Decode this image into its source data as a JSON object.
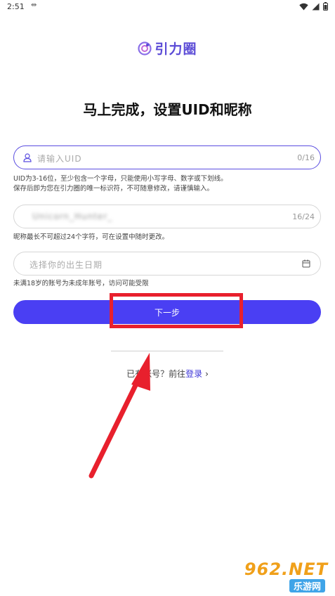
{
  "status_bar": {
    "time": "2:51",
    "extra": "⇹"
  },
  "logo": {
    "text": "引力圈"
  },
  "title": "马上完成，设置UID和昵称",
  "uid_field": {
    "placeholder": "请输入UID",
    "counter": "0/16"
  },
  "uid_hint": {
    "line1": "UID为3-16位，至少包含一个字母，只能使用小写字母、数字或下划线。",
    "line2": "保存后即为您在引力圈的唯一标识符，不可随意修改，请谨慎输入。"
  },
  "nickname_field": {
    "value": "Unicorn_Hunter_",
    "counter": "16/24"
  },
  "nickname_hint": "昵称最长不可超过24个字符，可在设置中随时更改。",
  "birthday_field": {
    "placeholder": "选择你的出生日期"
  },
  "birthday_hint": "未满18岁的账号为未成年账号，访问可能受限",
  "next_button": "下一步",
  "login_row": {
    "prefix": "已有账号？前往",
    "link": "登录",
    "chevron": "›"
  },
  "watermark": {
    "main": "962.NET",
    "sub": "乐游网"
  },
  "colors": {
    "accent": "#4a3ff3",
    "brand": "#5b4bd6",
    "annotation": "#e8202d"
  }
}
